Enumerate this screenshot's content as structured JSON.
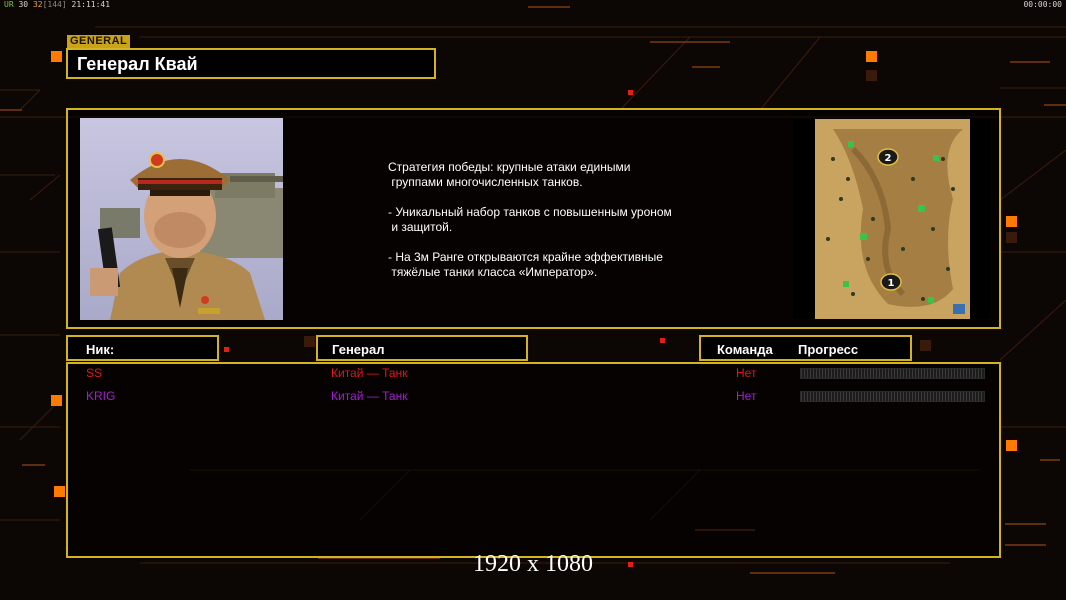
{
  "overlay": {
    "ur_label": "UR",
    "fps1": "30",
    "fps2": "32",
    "fps_bracket": "[144]",
    "clock": "21:11:41",
    "timer": "00:00:00"
  },
  "general": {
    "tag": "GENERAL",
    "name": "Генерал Квай",
    "portrait_icon": "general-kwai-portrait",
    "strategy": [
      "Стратегия победы: крупные атаки едиными\n группами многочисленных танков.",
      "- Уникальный набор танков с повышенным уроном\n и защитой.",
      "- На 3м Ранге открываются крайне эффективные\n тяжёлые танки класса «Император»."
    ],
    "map_icon": "desert-map-preview",
    "map_markers": [
      "1",
      "2"
    ]
  },
  "table": {
    "headers": {
      "nick": "Ник:",
      "general": "Генерал",
      "team": "Команда",
      "progress": "Прогресс"
    },
    "rows": [
      {
        "nick": "SS",
        "general": "Китай — Танк",
        "team": "Нет",
        "color": "#e01818",
        "progress": 0
      },
      {
        "nick": "KRIG",
        "general": "Китай — Танк",
        "team": "Нет",
        "color": "#a020d0",
        "progress": 0
      }
    ]
  },
  "resolution": "1920 x 1080",
  "colors": {
    "accent_gold": "#d2b420",
    "background": "#0c0604",
    "orange_squares": "#ff7a00"
  }
}
